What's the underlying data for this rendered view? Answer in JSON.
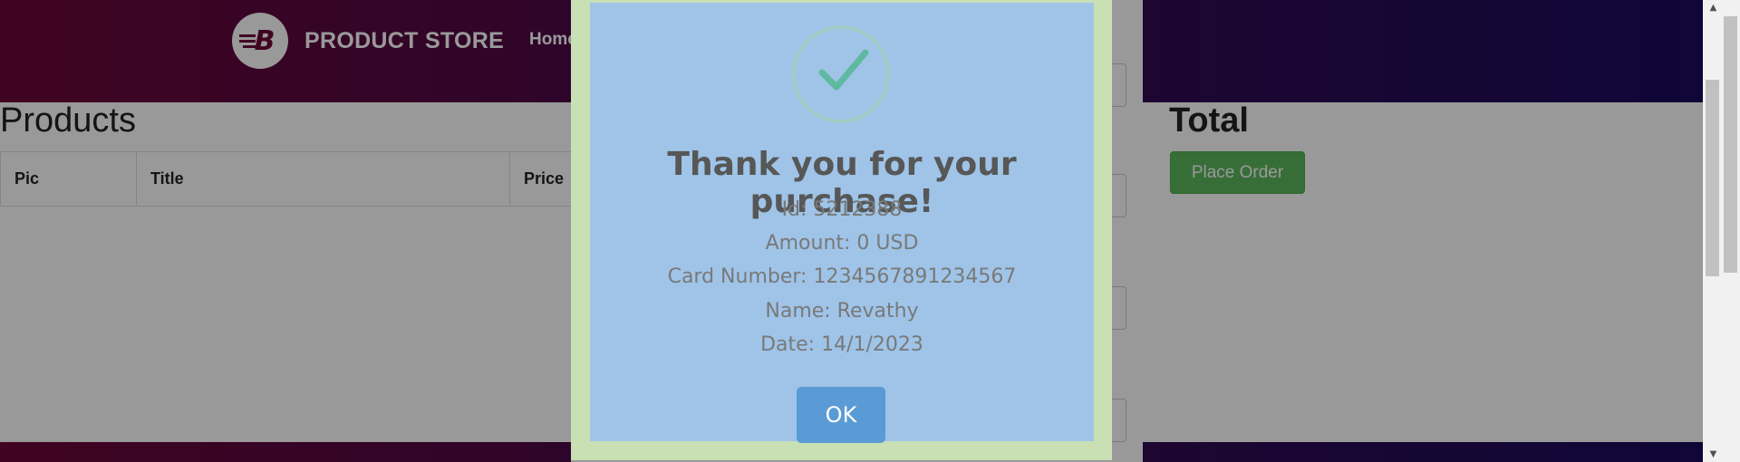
{
  "navbar": {
    "brand_name": "PRODUCT STORE",
    "logo_letter": "B",
    "nav_link": "Home"
  },
  "cart": {
    "products_heading": "Products",
    "columns": [
      "Pic",
      "Title",
      "Price"
    ],
    "total_heading": "Total",
    "place_order_label": "Place Order"
  },
  "sweet_alert": {
    "title": "Thank you for your purchase!",
    "lines": [
      "Id: 5212388",
      "Amount: 0 USD",
      "Card Number: 1234567891234567",
      "Name: Revathy",
      "Date: 14/1/2023"
    ],
    "ok_label": "OK",
    "icon": "checkmark-icon"
  },
  "scrollbar": {
    "up_arrow": "▲",
    "down_arrow": "▼"
  },
  "colors": {
    "navbar_start": "#6b0838",
    "navbar_end": "#1a0a5c",
    "success_green": "#5cb85c",
    "ok_blue": "#5b9bd5",
    "check_green": "#5fb9a0"
  }
}
